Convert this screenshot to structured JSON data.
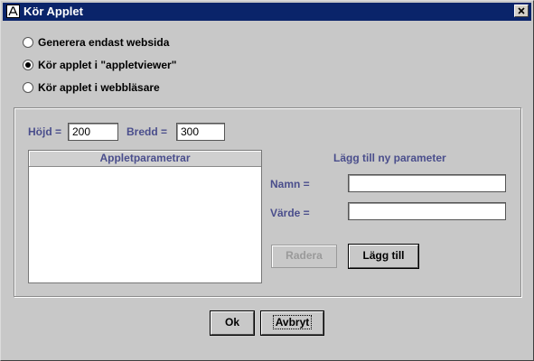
{
  "window": {
    "title": "Kör Applet"
  },
  "options": [
    {
      "label": "Generera endast websida",
      "selected": false
    },
    {
      "label": "Kör applet i \"appletviewer\"",
      "selected": true
    },
    {
      "label": "Kör applet i webbläsare",
      "selected": false
    }
  ],
  "size": {
    "height_label": "Höjd =",
    "height_value": "200",
    "width_label": "Bredd =",
    "width_value": "300"
  },
  "params_list": {
    "header": "Appletparametrar",
    "items": []
  },
  "new_param": {
    "title": "Lägg till ny parameter",
    "name_label": "Namn =",
    "name_value": "",
    "value_label": "Värde =",
    "value_value": ""
  },
  "buttons": {
    "delete": "Radera",
    "add": "Lägg till",
    "ok": "Ok",
    "cancel": "Avbryt"
  },
  "colors": {
    "titlebar": "#0a246a",
    "label_accent": "#4a4e8c",
    "dialog_bg": "#c8c8c8"
  }
}
